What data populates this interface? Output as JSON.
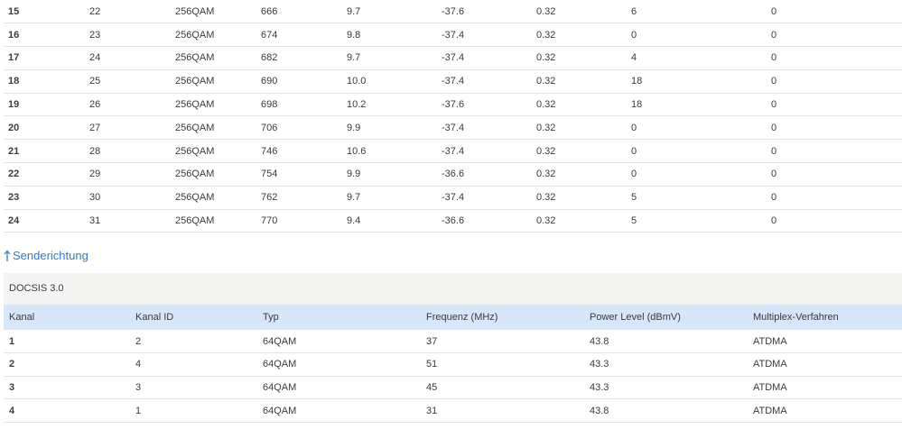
{
  "downstream": {
    "rows": [
      [
        "15",
        "22",
        "256QAM",
        "666",
        "9.7",
        "-37.6",
        "0.32",
        "6",
        "0"
      ],
      [
        "16",
        "23",
        "256QAM",
        "674",
        "9.8",
        "-37.4",
        "0.32",
        "0",
        "0"
      ],
      [
        "17",
        "24",
        "256QAM",
        "682",
        "9.7",
        "-37.4",
        "0.32",
        "4",
        "0"
      ],
      [
        "18",
        "25",
        "256QAM",
        "690",
        "10.0",
        "-37.4",
        "0.32",
        "18",
        "0"
      ],
      [
        "19",
        "26",
        "256QAM",
        "698",
        "10.2",
        "-37.6",
        "0.32",
        "18",
        "0"
      ],
      [
        "20",
        "27",
        "256QAM",
        "706",
        "9.9",
        "-37.4",
        "0.32",
        "0",
        "0"
      ],
      [
        "21",
        "28",
        "256QAM",
        "746",
        "10.6",
        "-37.4",
        "0.32",
        "0",
        "0"
      ],
      [
        "22",
        "29",
        "256QAM",
        "754",
        "9.9",
        "-36.6",
        "0.32",
        "0",
        "0"
      ],
      [
        "23",
        "30",
        "256QAM",
        "762",
        "9.7",
        "-37.4",
        "0.32",
        "5",
        "0"
      ],
      [
        "24",
        "31",
        "256QAM",
        "770",
        "9.4",
        "-36.6",
        "0.32",
        "5",
        "0"
      ]
    ]
  },
  "upstream": {
    "heading": "Senderichtung",
    "icon": "arrow-up-icon",
    "docsis_label": "DOCSIS 3.0",
    "columns": [
      "Kanal",
      "Kanal ID",
      "Typ",
      "Frequenz (MHz)",
      "Power Level (dBmV)",
      "Multiplex-Verfahren"
    ],
    "rows": [
      [
        "1",
        "2",
        "64QAM",
        "37",
        "43.8",
        "ATDMA"
      ],
      [
        "2",
        "4",
        "64QAM",
        "51",
        "43.3",
        "ATDMA"
      ],
      [
        "3",
        "3",
        "64QAM",
        "45",
        "43.3",
        "ATDMA"
      ],
      [
        "4",
        "1",
        "64QAM",
        "31",
        "43.8",
        "ATDMA"
      ]
    ]
  },
  "colors": {
    "accent": "#2f7ec7",
    "header_bg": "#d5e7f8",
    "section_bg": "#f4f4f2"
  }
}
